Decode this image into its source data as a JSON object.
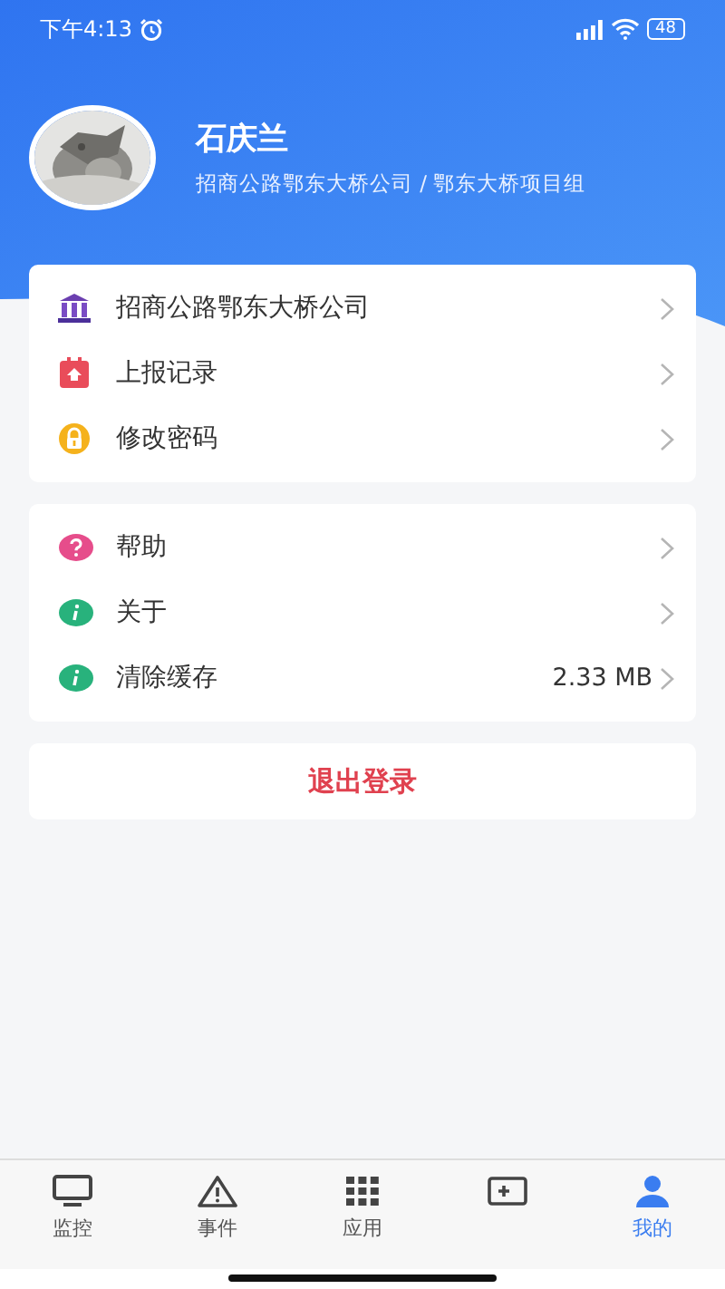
{
  "status_bar": {
    "time": "下午4:13",
    "battery": "48"
  },
  "profile": {
    "name": "石庆兰",
    "organization": "招商公路鄂东大桥公司 / 鄂东大桥项目组"
  },
  "menu_groups": [
    {
      "items": [
        {
          "kind": "bank",
          "label": "招商公路鄂东大桥公司"
        },
        {
          "kind": "report",
          "label": "上报记录"
        },
        {
          "kind": "lock",
          "label": "修改密码"
        }
      ]
    },
    {
      "items": [
        {
          "kind": "help",
          "label": "帮助"
        },
        {
          "kind": "info",
          "label": "关于"
        },
        {
          "kind": "info",
          "label": "清除缓存",
          "value": "2.33 MB"
        }
      ]
    }
  ],
  "logout_button": "退出登录",
  "tab_bar": [
    {
      "kind": "monitor",
      "label": "监控",
      "selected": false
    },
    {
      "kind": "warning",
      "label": "事件",
      "selected": false
    },
    {
      "kind": "grid",
      "label": "应用",
      "selected": false
    },
    {
      "kind": "ticket",
      "selected": false
    },
    {
      "kind": "person",
      "label": "我的",
      "selected": true
    }
  ]
}
